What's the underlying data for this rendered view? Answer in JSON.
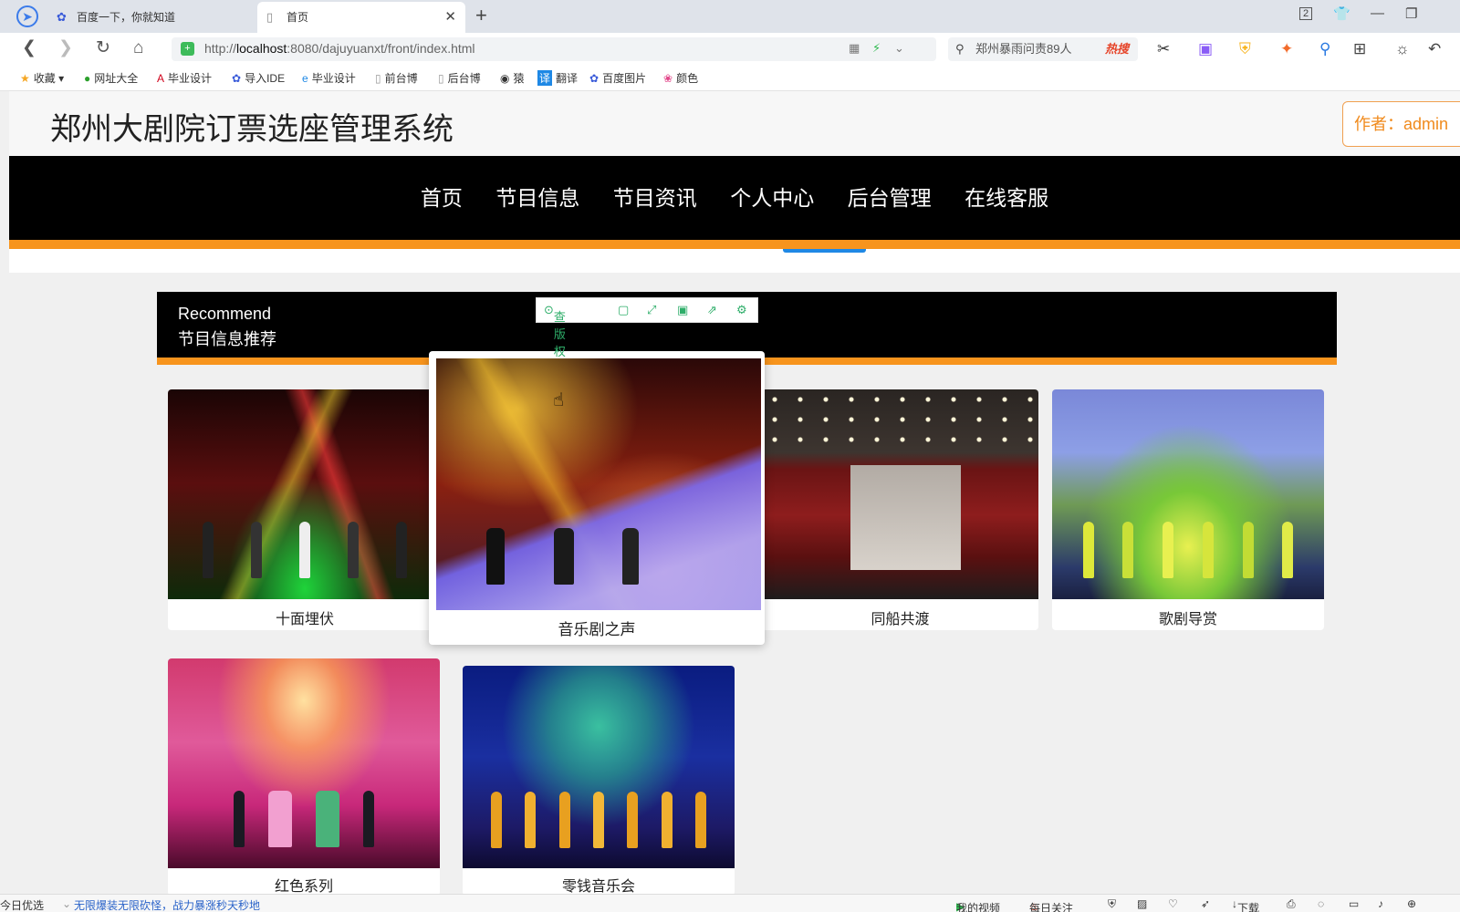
{
  "browser": {
    "tabs": [
      {
        "label": "百度一下，你就知道"
      },
      {
        "label": "首页"
      }
    ],
    "url": {
      "prefix": "http://",
      "host": "localhost",
      "rest": ":8080/dajuyuanxt/front/index.html"
    },
    "search": {
      "text": "郑州暴雨问责89人",
      "hot": "热搜"
    },
    "bookmarks": [
      "收藏",
      "网址大全",
      "毕业设计",
      "导入IDE",
      "毕业设计",
      "前台博",
      "后台博",
      "猿",
      "翻译",
      "百度图片",
      "颜色"
    ],
    "tab_count": "2"
  },
  "header": {
    "title": "郑州大剧院订票选座管理系统",
    "author": "作者：admin"
  },
  "nav": [
    "首页",
    "节目信息",
    "节目资讯",
    "个人中心",
    "后台管理",
    "在线客服"
  ],
  "recommend": {
    "en": "Recommend",
    "cn": "节目信息推荐"
  },
  "image_toolbar": {
    "copyright": "查版权"
  },
  "programs": [
    {
      "name": "十面埋伏"
    },
    {
      "name": "音乐剧之声"
    },
    {
      "name": "同船共渡"
    },
    {
      "name": "歌剧导赏"
    },
    {
      "name": "红色系列"
    },
    {
      "name": "零钱音乐会"
    }
  ],
  "statusbar": {
    "left": "今日优选",
    "ad": "无限爆装无限砍怪，战力暴涨秒天秒地",
    "video": "我的视频",
    "follow": "每日关注",
    "download": "下载"
  }
}
